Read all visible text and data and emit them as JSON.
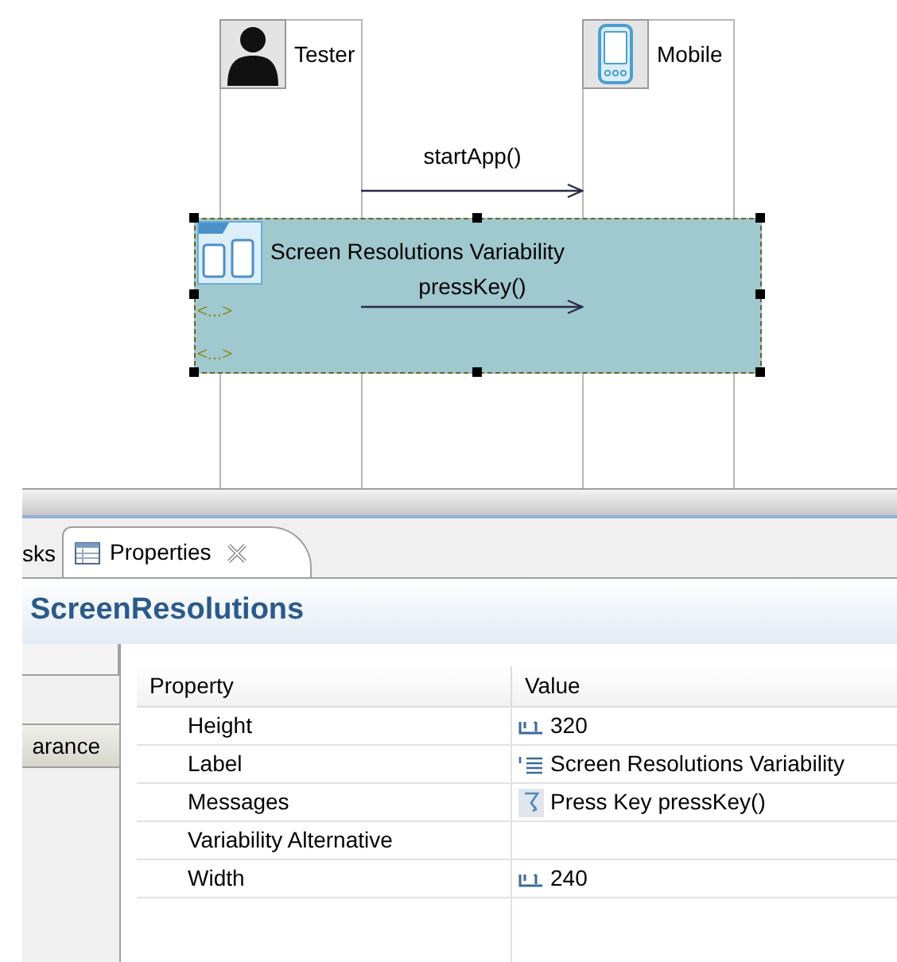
{
  "diagram": {
    "lifelines": [
      {
        "name": "Tester",
        "kind": "person"
      },
      {
        "name": "Mobile",
        "kind": "device"
      }
    ],
    "messages": [
      {
        "label": "startApp()"
      }
    ],
    "fragment": {
      "title": "Screen Resolutions Variability",
      "selected": true,
      "messages": [
        {
          "label": "pressKey()"
        }
      ],
      "alternatives": [
        "<...>",
        "<...>"
      ]
    }
  },
  "panel": {
    "tabs": [
      {
        "label": "sks",
        "selected": false
      },
      {
        "label": "Properties",
        "selected": true
      }
    ],
    "title": "ScreenResolutions",
    "sidebar_tabs": [
      {
        "label": "arance"
      }
    ],
    "table": {
      "columns": [
        "Property",
        "Value"
      ],
      "rows": [
        {
          "property": "Height",
          "value": "320",
          "kind": "number"
        },
        {
          "property": "Label",
          "value": "Screen Resolutions Variability",
          "kind": "text"
        },
        {
          "property": "Messages",
          "value": "Press Key pressKey()",
          "kind": "message"
        },
        {
          "property": "Variability Alternative",
          "value": "",
          "kind": "empty"
        },
        {
          "property": "Width",
          "value": "240",
          "kind": "number"
        }
      ]
    }
  }
}
